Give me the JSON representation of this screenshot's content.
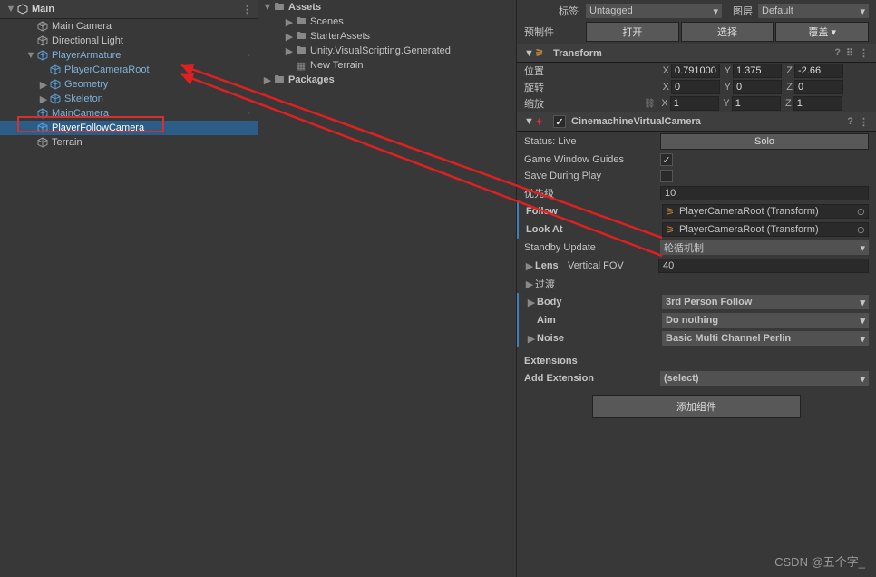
{
  "hierarchy": {
    "root": "Main",
    "items": [
      {
        "label": "Main Camera",
        "indent": 2,
        "type": "obj"
      },
      {
        "label": "Directional Light",
        "indent": 2,
        "type": "obj"
      },
      {
        "label": "PlayerArmature",
        "indent": 2,
        "type": "prefab",
        "expanded": true,
        "hasArrow": true
      },
      {
        "label": "PlayerCameraRoot",
        "indent": 3,
        "type": "prefab"
      },
      {
        "label": "Geometry",
        "indent": 3,
        "type": "prefab",
        "collapsed": true
      },
      {
        "label": "Skeleton",
        "indent": 3,
        "type": "prefab",
        "collapsed": true
      },
      {
        "label": "MainCamera",
        "indent": 2,
        "type": "prefab",
        "hasArrow": true,
        "warn": true
      },
      {
        "label": "PlayerFollowCamera",
        "indent": 2,
        "type": "prefab",
        "selected": true,
        "hasArrow": true
      },
      {
        "label": "Terrain",
        "indent": 2,
        "type": "obj"
      }
    ]
  },
  "project": {
    "assets": "Assets",
    "items": [
      {
        "label": "Scenes",
        "indent": 2
      },
      {
        "label": "StarterAssets",
        "indent": 2
      },
      {
        "label": "Unity.VisualScripting.Generated",
        "indent": 2
      },
      {
        "label": "New Terrain",
        "indent": 2,
        "asset": true
      }
    ],
    "packages": "Packages"
  },
  "inspector": {
    "tag_label": "标签",
    "tag_value": "Untagged",
    "layer_label": "图层",
    "layer_value": "Default",
    "prefab_label": "预制件",
    "btn_open": "打开",
    "btn_select": "选择",
    "btn_override": "覆盖",
    "transform": {
      "title": "Transform",
      "pos_label": "位置",
      "rot_label": "旋转",
      "scale_label": "缩放",
      "pos": {
        "x": "0.7910001",
        "y": "1.375",
        "z": "-2.66"
      },
      "rot": {
        "x": "0",
        "y": "0",
        "z": "0"
      },
      "scale": {
        "x": "1",
        "y": "1",
        "z": "1"
      }
    },
    "cinemachine": {
      "title": "CinemachineVirtualCamera",
      "status_label": "Status: Live",
      "solo_btn": "Solo",
      "guides_label": "Game Window Guides",
      "save_label": "Save During Play",
      "priority_label": "优先级",
      "priority_value": "10",
      "follow_label": "Follow",
      "lookat_label": "Look At",
      "target_value": "PlayerCameraRoot (Transform)",
      "standby_label": "Standby Update",
      "standby_value": "轮循机制",
      "lens_label": "Lens",
      "lens_sub": "Vertical FOV",
      "lens_value": "40",
      "transition_label": "过渡",
      "body_label": "Body",
      "body_value": "3rd Person Follow",
      "aim_label": "Aim",
      "aim_value": "Do nothing",
      "noise_label": "Noise",
      "noise_value": "Basic Multi Channel Perlin",
      "ext_label": "Extensions",
      "addext_label": "Add Extension",
      "addext_value": "(select)"
    },
    "add_component": "添加组件"
  },
  "watermark": "CSDN @五个字_"
}
